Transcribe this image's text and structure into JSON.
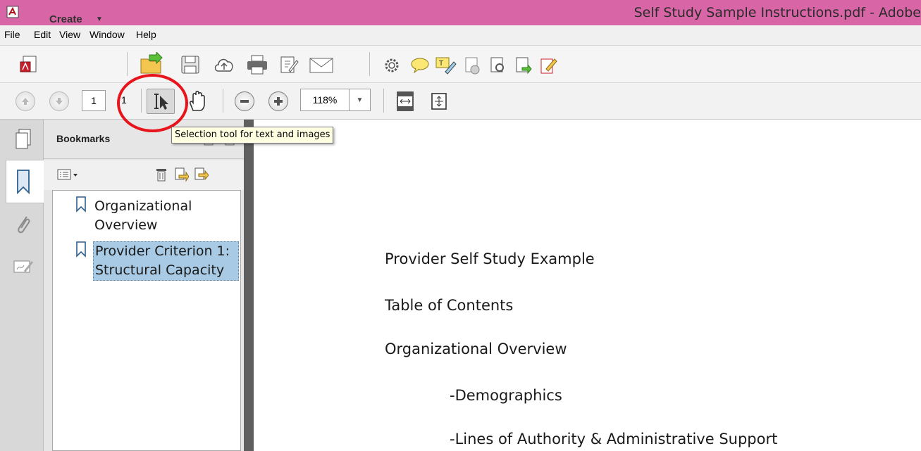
{
  "window": {
    "title": "Self Study Sample Instructions.pdf - Adobe"
  },
  "menu": {
    "items": [
      "File",
      "Edit",
      "View",
      "Window",
      "Help"
    ]
  },
  "toolbar": {
    "create_label": "Create",
    "tools": [
      "open-icon",
      "save-icon",
      "cloud-upload-icon",
      "print-icon",
      "edit-icon",
      "email-icon",
      "gear-icon",
      "comment-icon",
      "highlight-icon",
      "sign-icon",
      "stamp-icon",
      "search-doc-icon",
      "export-icon",
      "form-icon"
    ]
  },
  "navigation": {
    "current_page": "1",
    "total_pages": "1",
    "zoom": "118%"
  },
  "tooltip": {
    "text": "Selection tool for text and images"
  },
  "bookmarks": {
    "title": "Bookmarks",
    "items": [
      {
        "label_line1": "Organizational",
        "label_line2": "Overview",
        "selected": false
      },
      {
        "label_line1": "Provider Criterion 1:",
        "label_line2": "Structural Capacity",
        "selected": true
      }
    ]
  },
  "document": {
    "lines": [
      "Provider Self Study Example",
      "Table of Contents",
      "Organizational Overview",
      "-Demographics",
      "-Lines of Authority & Administrative Support"
    ]
  },
  "colors": {
    "titlebar": "#d865a6",
    "highlight_circle": "#e8141b",
    "bookmark_selected": "#a8cae4"
  }
}
